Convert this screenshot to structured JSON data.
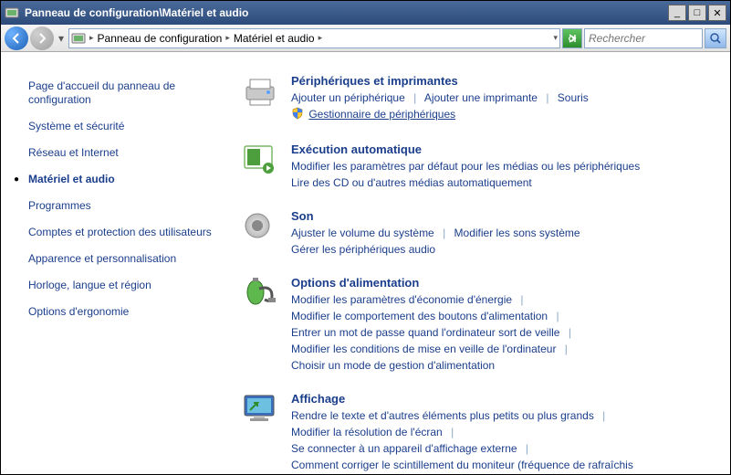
{
  "window": {
    "title": "Panneau de configuration\\Matériel et audio"
  },
  "breadcrumb": {
    "item1": "Panneau de configuration",
    "item2": "Matériel et audio"
  },
  "search": {
    "placeholder": "Rechercher"
  },
  "sidebar": {
    "items": [
      "Page d'accueil du panneau de configuration",
      "Système et sécurité",
      "Réseau et Internet",
      "Matériel et audio",
      "Programmes",
      "Comptes et protection des utilisateurs",
      "Apparence et personnalisation",
      "Horloge, langue et région",
      "Options d'ergonomie"
    ],
    "active_index": 3
  },
  "categories": {
    "devices": {
      "title": "Périphériques et imprimantes",
      "links": {
        "add_device": "Ajouter un périphérique",
        "add_printer": "Ajouter une imprimante",
        "mouse": "Souris",
        "device_manager": "Gestionnaire de périphériques"
      }
    },
    "autoplay": {
      "title": "Exécution automatique",
      "links": {
        "defaults": "Modifier les paramètres par défaut pour les médias ou les périphériques",
        "cds": "Lire des CD ou d'autres médias automatiquement"
      }
    },
    "sound": {
      "title": "Son",
      "links": {
        "volume": "Ajuster le volume du système",
        "sounds": "Modifier les sons système",
        "audio_devices": "Gérer les périphériques audio"
      }
    },
    "power": {
      "title": "Options d'alimentation",
      "links": {
        "eco": "Modifier les paramètres d'économie d'énergie",
        "buttons": "Modifier le comportement des boutons d'alimentation",
        "password": "Entrer un mot de passe quand l'ordinateur sort de veille",
        "sleep": "Modifier les conditions de mise en veille de l'ordinateur",
        "plan": "Choisir un mode de gestion d'alimentation"
      }
    },
    "display": {
      "title": "Affichage",
      "links": {
        "textsize": "Rendre le texte et d'autres éléments plus petits ou plus grands",
        "resolution": "Modifier la résolution de l'écran",
        "external": "Se connecter à un appareil d'affichage externe",
        "flicker": "Comment corriger le scintillement du moniteur (fréquence de rafraîchis"
      }
    }
  }
}
